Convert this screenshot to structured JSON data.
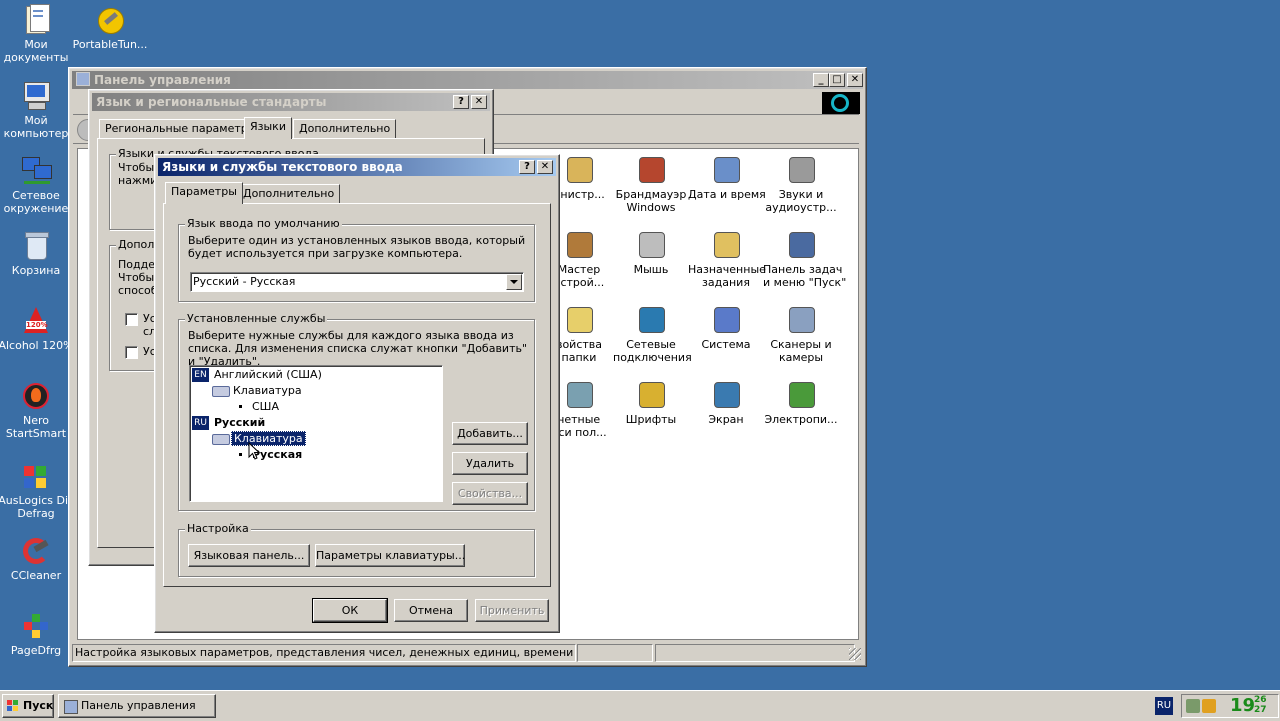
{
  "desktop": {
    "icons": [
      {
        "label_l1": "Мои",
        "label_l2": "документы",
        "icon": "my-documents-icon"
      },
      {
        "label_l1": "PortableTun...",
        "label_l2": "",
        "icon": "portable-tuneup-icon"
      },
      {
        "label_l1": "Мой",
        "label_l2": "компьютер",
        "icon": "my-computer-icon"
      },
      {
        "label_l1": "Сетевое",
        "label_l2": "окружение",
        "icon": "network-places-icon"
      },
      {
        "label_l1": "Корзина",
        "label_l2": "",
        "icon": "recycle-bin-icon"
      },
      {
        "label_l1": "Alcohol 120%",
        "label_l2": "",
        "icon": "alcohol-icon"
      },
      {
        "label_l1": "Nero",
        "label_l2": "StartSmart",
        "icon": "nero-icon"
      },
      {
        "label_l1": "AusLogics Dis",
        "label_l2": "Defrag",
        "icon": "auslogics-icon"
      },
      {
        "label_l1": "CCleaner",
        "label_l2": "",
        "icon": "ccleaner-icon"
      },
      {
        "label_l1": "PageDfrg",
        "label_l2": "",
        "icon": "pagedfrg-icon"
      }
    ]
  },
  "control_panel": {
    "title": "Панель управления",
    "status_text": "Настройка языковых параметров, представления чисел, денежных единиц, времени и дат.",
    "items": [
      {
        "l1": "инистр...",
        "l2": "",
        "icon": "admin-tools-icon"
      },
      {
        "l1": "Брандмауэр",
        "l2": "Windows",
        "icon": "firewall-icon"
      },
      {
        "l1": "Дата и время",
        "l2": "",
        "icon": "date-time-icon"
      },
      {
        "l1": "Звуки и",
        "l2": "аудиоустр...",
        "icon": "sounds-icon"
      },
      {
        "l1": "Мастер",
        "l2": "астрой...",
        "icon": "wizard-icon"
      },
      {
        "l1": "Мышь",
        "l2": "",
        "icon": "mouse-icon"
      },
      {
        "l1": "Назначенные",
        "l2": "задания",
        "icon": "scheduled-tasks-icon"
      },
      {
        "l1": "Панель задач",
        "l2": "и меню \"Пуск\"",
        "icon": "taskbar-menu-icon"
      },
      {
        "l1": "войства",
        "l2": "папки",
        "icon": "folder-options-icon"
      },
      {
        "l1": "Сетевые",
        "l2": "подключения",
        "icon": "network-connections-icon"
      },
      {
        "l1": "Система",
        "l2": "",
        "icon": "system-icon"
      },
      {
        "l1": "Сканеры и",
        "l2": "камеры",
        "icon": "scanners-icon"
      },
      {
        "l1": "четные",
        "l2": "иси пол...",
        "icon": "user-accounts-icon"
      },
      {
        "l1": "Шрифты",
        "l2": "",
        "icon": "fonts-icon"
      },
      {
        "l1": "Экран",
        "l2": "",
        "icon": "display-icon"
      },
      {
        "l1": "Электропи...",
        "l2": "",
        "icon": "power-icon"
      }
    ]
  },
  "regional_dialog": {
    "title": "Язык и региональные стандарты",
    "help": "?",
    "close": "✕",
    "tabs": [
      "Региональные параметры",
      "Языки",
      "Дополнительно"
    ],
    "group1_label": "Языки и службы текстового ввода",
    "group1_text_l1": "Чтобы",
    "group1_text_l2": "нажми",
    "group2_label": "Допол",
    "group2_l1": "Подде",
    "group2_l2": "Чтобы",
    "group2_l3": "способ",
    "check1": "Ус",
    "check1b": "сл",
    "check2": "Ус"
  },
  "text_services_dialog": {
    "title": "Языки и службы текстового ввода",
    "help": "?",
    "close": "✕",
    "tabs": [
      "Параметры",
      "Дополнительно"
    ],
    "default_group_label": "Язык ввода по умолчанию",
    "default_desc": "Выберите один из установленных языков ввода, который будет используется при загрузке компьютера.",
    "default_value": "Русский - Русская",
    "installed_group_label": "Установленные службы",
    "installed_desc": "Выберите нужные службы для каждого языка ввода из списка. Для изменения списка служат кнопки \"Добавить\" и \"Удалить\".",
    "tree": {
      "en_badge": "EN",
      "en_lang": "Английский (США)",
      "en_kb": "Клавиатура",
      "en_layout": "США",
      "ru_badge": "RU",
      "ru_lang": "Русский",
      "ru_kb": "Клавиатура",
      "ru_layout": "Русская"
    },
    "add_btn": "Добавить...",
    "remove_btn": "Удалить",
    "props_btn": "Свойства...",
    "settings_group_label": "Настройка",
    "lang_bar_btn": "Языковая панель...",
    "kb_settings_btn": "Параметры клавиатуры...",
    "ok_btn": "ОК",
    "cancel_btn": "Отмена",
    "apply_btn": "Применить"
  },
  "taskbar": {
    "start_label": "Пуск",
    "task_label": "Панель управления",
    "lang_indicator": "RU",
    "clock_hours": "19",
    "clock_min_top": "26",
    "clock_min_bot": "27"
  },
  "colors": {
    "desktop": "#3a6ea5",
    "titlebar_active": "#0a246a",
    "face": "#d4d0c8",
    "selection": "#0a246a"
  }
}
